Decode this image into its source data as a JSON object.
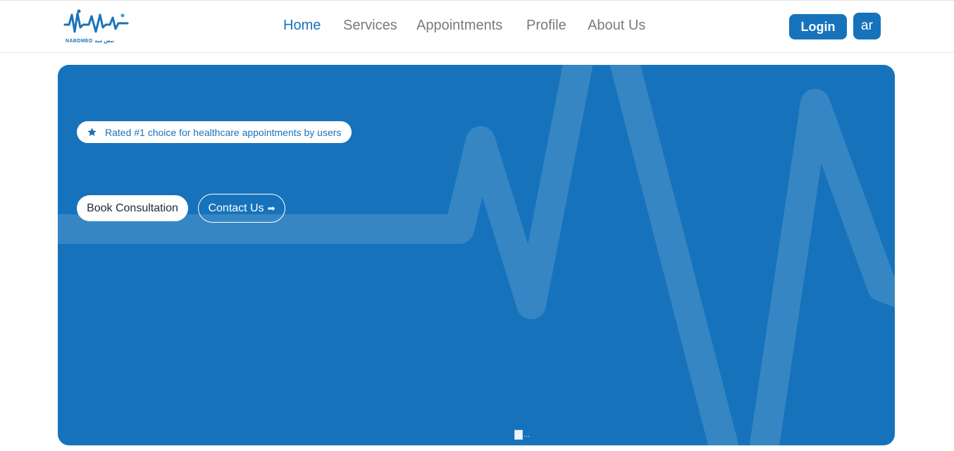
{
  "brand": {
    "name": "NABDMED",
    "name_ar": "نبض ميد"
  },
  "nav": {
    "items": [
      {
        "label": "Home",
        "active": true
      },
      {
        "label": "Services",
        "active": false
      },
      {
        "label": "Appointments",
        "active": false
      },
      {
        "label": "Profile",
        "active": false
      },
      {
        "label": "About Us",
        "active": false
      }
    ]
  },
  "header": {
    "login_label": "Login",
    "lang_label": "ar"
  },
  "hero": {
    "badge_text": "Rated #1 choice for healthcare appointments by users",
    "book_label": "Book Consultation",
    "contact_label": "Contact Us",
    "contact_arrow": "➡",
    "image_alt": "..."
  },
  "colors": {
    "primary": "#1673bb",
    "nav_active": "#1a73ba",
    "nav_inactive": "#7a7a7a"
  }
}
